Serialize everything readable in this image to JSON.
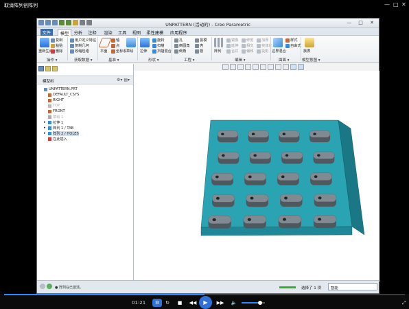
{
  "player": {
    "title": "取消阵列创阵列",
    "current_time": "01:21",
    "progress_fraction": 0.5,
    "volume_fraction": 0.78
  },
  "app": {
    "title": "UNPATTERN (活动的) - Creo Parametric",
    "menu": [
      "文件",
      "模型",
      "分析",
      "注释",
      "渲染",
      "工具",
      "视图",
      "柔性建模",
      "应用程序"
    ],
    "active_menu": "模型",
    "ribbon": {
      "groups": [
        {
          "label": "操作"
        },
        {
          "label": "获取数据"
        },
        {
          "label": "基准"
        },
        {
          "label": "形状"
        },
        {
          "label": "工程"
        },
        {
          "label": "编辑"
        },
        {
          "label": "曲面"
        },
        {
          "label": "模型意图"
        }
      ],
      "buttons": {
        "regenerate": "重新生成",
        "copy": "复制",
        "paste": "粘贴",
        "delete": "删除",
        "user_defined_feature": "用户定义特征",
        "copy_geometry": "复制几何",
        "shrinkwrap": "收缩包络",
        "plane": "平面",
        "axis": "轴",
        "point": "点",
        "coord_sys": "坐标系",
        "sketch": "草绘",
        "extrude": "拉伸",
        "revolve": "旋转",
        "sweep": "扫描",
        "swept_blend": "扫描混合",
        "hole": "孔",
        "round": "倒圆角",
        "chamfer": "倒角",
        "draft": "拔模",
        "shell": "壳",
        "rib": "筋",
        "pattern": "阵列",
        "mirror": "镜像",
        "extend": "延伸",
        "trim": "修剪",
        "merge": "合并",
        "intersect": "相交",
        "offset": "偏移",
        "thicken": "加厚",
        "solidify": "实体化",
        "project": "投影",
        "boundary_blend": "边界混合",
        "freestyle": "自由式",
        "style": "样式",
        "family_table": "族表",
        "annotation": "注释"
      }
    },
    "model_tree": {
      "header": "模型树",
      "items": [
        {
          "label": "UNPATTERN.PRT",
          "indent": 0,
          "dim": false,
          "expander": ""
        },
        {
          "label": "DEFAULT_CSYS",
          "indent": 1,
          "dim": false,
          "expander": ""
        },
        {
          "label": "RIGHT",
          "indent": 1,
          "dim": false,
          "expander": ""
        },
        {
          "label": "TOP",
          "indent": 1,
          "dim": true,
          "expander": ""
        },
        {
          "label": "FRONT",
          "indent": 1,
          "dim": false,
          "expander": ""
        },
        {
          "label": "草绘 1",
          "indent": 1,
          "dim": true,
          "expander": ""
        },
        {
          "label": "拉伸 1",
          "indent": 1,
          "dim": false,
          "expander": "▸"
        },
        {
          "label": "阵列 1 / TAB",
          "indent": 1,
          "dim": false,
          "expander": "▸"
        },
        {
          "label": "阵列 2 / HOLES",
          "indent": 1,
          "dim": false,
          "expander": "▸",
          "selected": true
        },
        {
          "label": "在此插入",
          "indent": 1,
          "dim": false,
          "expander": ""
        }
      ]
    },
    "status": {
      "message": "● 阵列在已激活。",
      "selection": "选择了 1 项",
      "filter": "智能"
    },
    "colors": {
      "plate_top": "#2aa3b3",
      "plate_side": "#1a7785",
      "tab": "#7f8a93",
      "accent": "#3a6ea5"
    }
  }
}
